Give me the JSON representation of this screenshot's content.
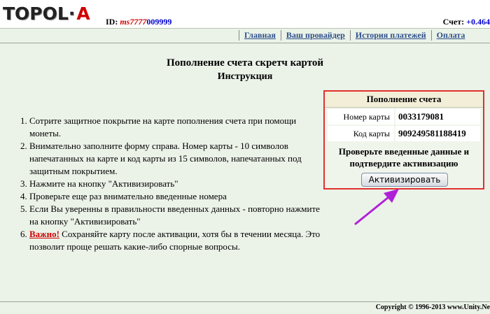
{
  "header": {
    "logo_text": "TOPOL",
    "logo_accent": "A",
    "id_label": "ID:",
    "id_login": "ms7777",
    "id_number": "009999",
    "balance_label": "Счет:",
    "balance_value": "+0.464"
  },
  "nav": {
    "items": [
      {
        "label": "Главная"
      },
      {
        "label": "Ваш провайдер"
      },
      {
        "label": "История платежей"
      },
      {
        "label": "Оплата"
      }
    ]
  },
  "page": {
    "title": "Пополнение счета скретч картой",
    "subtitle": "Инструкция"
  },
  "instructions": {
    "items": [
      "Сотрите защитное покрытие на карте пополнения счета при помощи монеты.",
      "Внимательно заполните форму справа. Номер карты - 10 символов напечатанных на карте и код карты из 15 символов, напечатанных под защитным покрытием.",
      "Нажмите на кнопку \"Активизировать\"",
      "Проверьте еще раз внимательно введенные номера",
      "Если Вы уверенны в правильности введенных данных - повторно нажмите на кнопку \"Активизировать\""
    ],
    "important_label": "Важно!",
    "important_text": " Сохраняйте карту после активации, хотя бы в течении месяца. Это позволит проще решать какие-либо спорные вопросы."
  },
  "panel": {
    "title": "Пополнение счета",
    "card_number_label": "Номер карты",
    "card_number_value": "0033179081",
    "card_code_label": "Код карты",
    "card_code_value": "909249581188419",
    "note": "Проверьте введенные данные и подтвердите активизацию",
    "activate_label": "Активизировать"
  },
  "footer": {
    "copyright": "Copyright © 1996-2013 www.Unity.Ne"
  },
  "colors": {
    "background": "#ebf2e8",
    "accent_red": "#d00000",
    "link_blue": "#2b4e8a",
    "arrow": "#b020d8"
  }
}
